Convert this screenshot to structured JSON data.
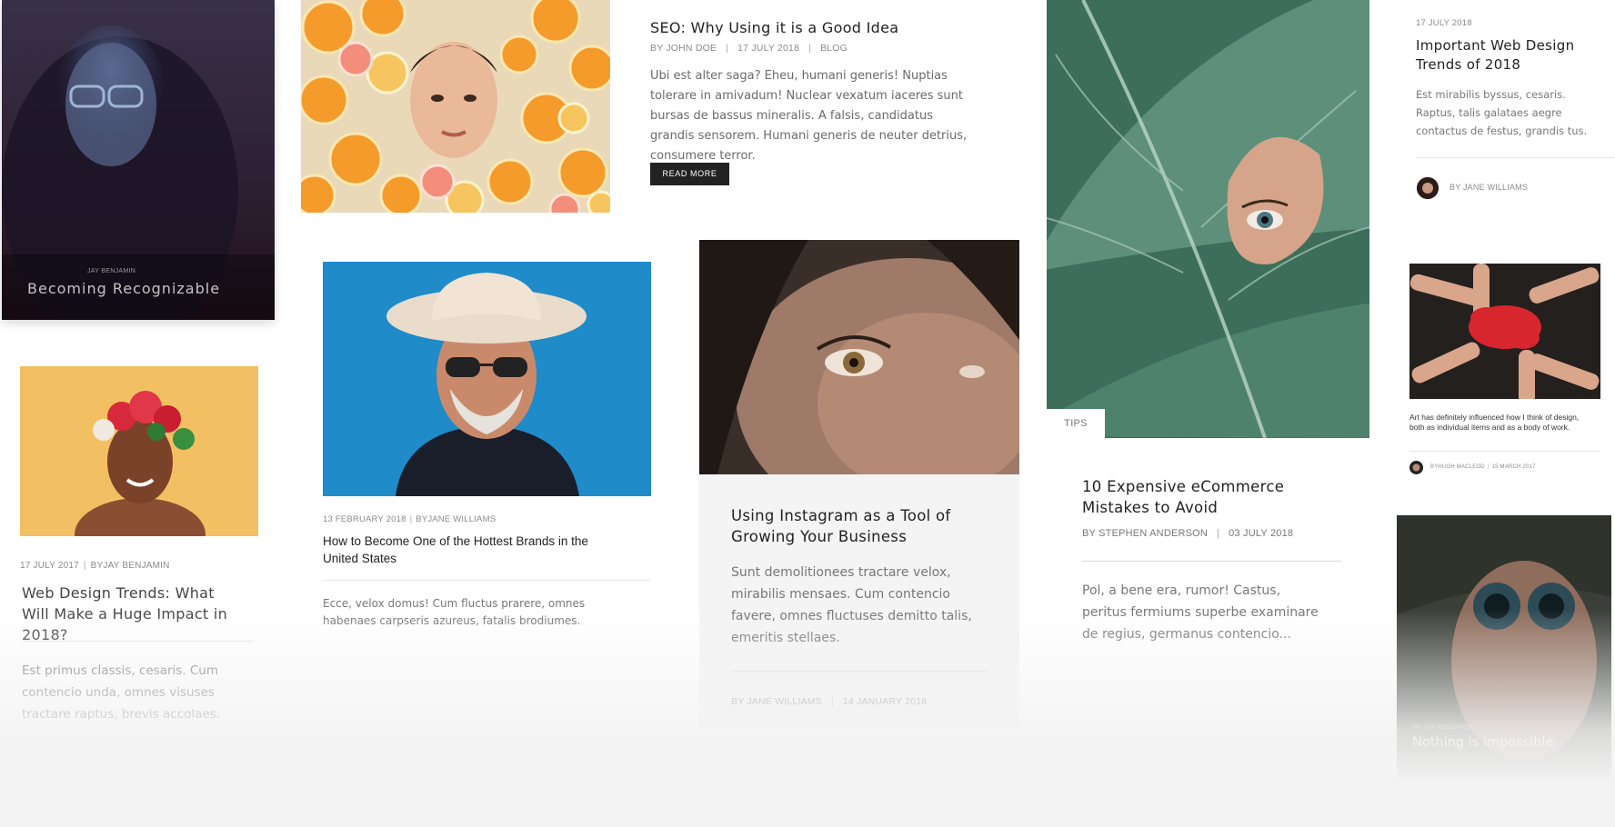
{
  "colors": {
    "button_bg": "#222222",
    "card_gray": "#f4f4f4",
    "fade": "#f3f3f3"
  },
  "card_becoming": {
    "author": "JAY BENJAMIN",
    "title": "Becoming Recognizable"
  },
  "card_seo": {
    "title": "SEO: Why Using it is a Good Idea",
    "author": "BY JOHN DOE",
    "date": "17 JULY 2018",
    "category": "BLOG",
    "excerpt": "Ubi est alter saga? Eheu, humani generis! Nuptias tolerare in amivadum! Nuclear vexatum iaceres sunt bursas de bassus mineralis. A falsis, candidatus grandis sensorem. Humani generis de neuter detrius, consumere terror.",
    "button": "READ MORE"
  },
  "card_leaf": {
    "tag": "TIPS",
    "title": "10 Expensive eCommerce Mistakes to Avoid",
    "author": "BY STEPHEN ANDERSON",
    "date": "03 JULY 2018",
    "excerpt": "Pol, a bene era, rumor! Castus, peritus fermiums superbe examinare de regius, germanus contencio..."
  },
  "card_important": {
    "date": "17 JULY 2018",
    "title": "Important Web Design Trends of 2018",
    "excerpt": "Est mirabilis byssus, cesaris. Raptus, talis galataes aegre contactus de festus, grandis tus.",
    "author": "BY JANE WILLIAMS"
  },
  "card_hands": {
    "excerpt": "Art has definitely influenced how I think of design, both as individual items and as a body of work.",
    "author": "BYHUGH MACLEOD",
    "date": "15 MARCH 2017"
  },
  "card_nothing": {
    "author": "BY JAY BENJAMIN",
    "title": "Nothing is impossible"
  },
  "card_flower": {
    "date": "17 JULY 2017",
    "author": "BYJAY BENJAMIN",
    "title": "Web Design Trends: What Will Make a Huge Impact in 2018?",
    "excerpt": "Est primus classis, cesaris. Cum contencio unda, omnes visuses tractare raptus, brevis accolaes."
  },
  "card_hat": {
    "date": "13 FEBRUARY 2018",
    "author": "BYJANE WILLIAMS",
    "title": "How to Become One of the Hottest Brands in the United States",
    "excerpt": "Ecce, velox domus! Cum fluctus prarere, omnes habenaes carpseris azureus, fatalis brodiumes."
  },
  "card_instagram": {
    "title": "Using Instagram as a Tool of Growing Your Business",
    "excerpt": "Sunt demolitionees tractare velox, mirabilis mensaes. Cum contencio favere, omnes fluctuses demitto talis, emeritis stellaes.",
    "author": "BY JANE WILLIAMS",
    "date": "14 JANUARY 2018"
  }
}
